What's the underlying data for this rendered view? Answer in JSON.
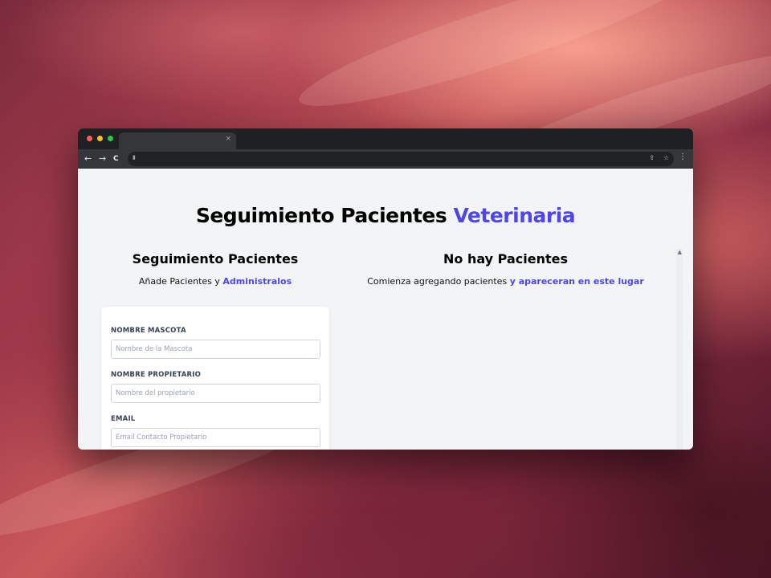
{
  "page": {
    "title_main": "Seguimiento Pacientes",
    "title_accent": "Veterinaria"
  },
  "form_section": {
    "title": "Seguimiento Pacientes",
    "subtitle_plain": "Añade Pacientes y",
    "subtitle_accent": "Administralos",
    "fields": [
      {
        "label": "NOMBRE MASCOTA",
        "placeholder": "Nombre de la Mascota",
        "value": ""
      },
      {
        "label": "NOMBRE PROPIETARIO",
        "placeholder": "Nombre del propietario",
        "value": ""
      },
      {
        "label": "EMAIL",
        "placeholder": "Email Contacto Propietario",
        "value": ""
      }
    ]
  },
  "list_section": {
    "title": "No hay Pacientes",
    "subtitle_plain": "Comienza agregando pacientes",
    "subtitle_accent": "y apareceran en este lugar"
  },
  "browser": {
    "tab_close": "×",
    "back_icon": "←",
    "forward_icon": "→",
    "reload_icon": "C",
    "share_icon": "⇪",
    "star_icon": "☆",
    "menu_icon": "⋮"
  },
  "colors": {
    "accent": "#4f46e5",
    "page_bg": "#f3f4f6",
    "card_bg": "#ffffff"
  }
}
